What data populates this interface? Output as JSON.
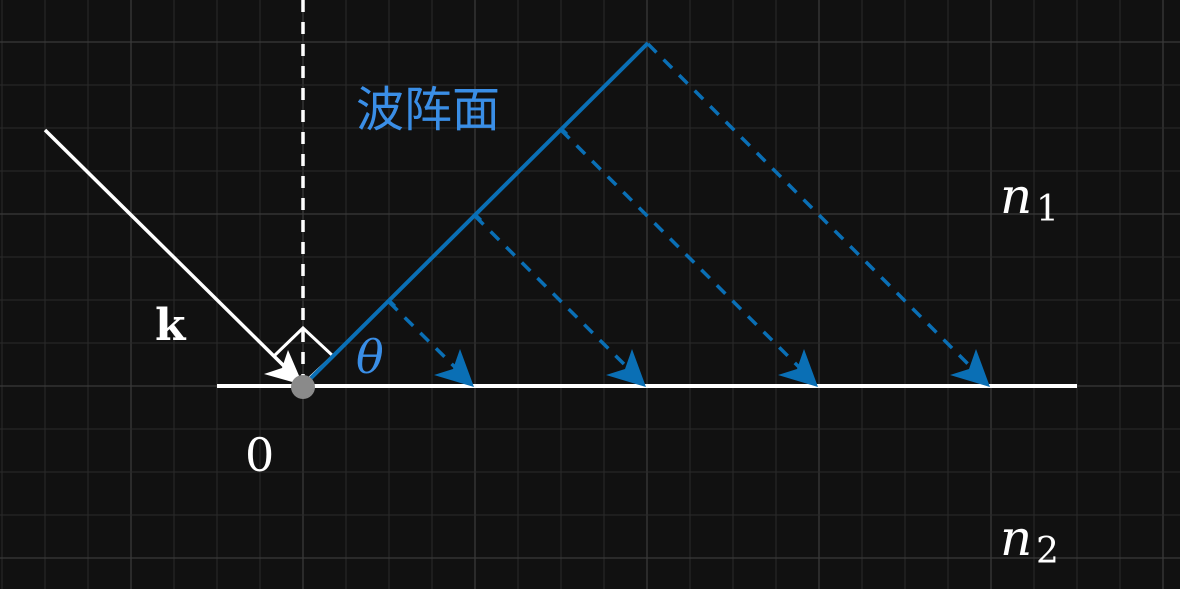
{
  "diagram": {
    "wavefront_label": "波阵面",
    "vector_label": "k",
    "angle_label": "θ",
    "origin_label": "0",
    "medium_upper_label": "n",
    "medium_upper_sub": "1",
    "medium_lower_label": "n",
    "medium_lower_sub": "2"
  },
  "colors": {
    "background": "#111111",
    "grid_minor": "#2a2a2a",
    "grid_major": "#3a3a3a",
    "white": "#ffffff",
    "wave_blue": "#0a6fb5",
    "label_blue": "#3a8ee6",
    "origin_dot": "#8a8a8a"
  }
}
